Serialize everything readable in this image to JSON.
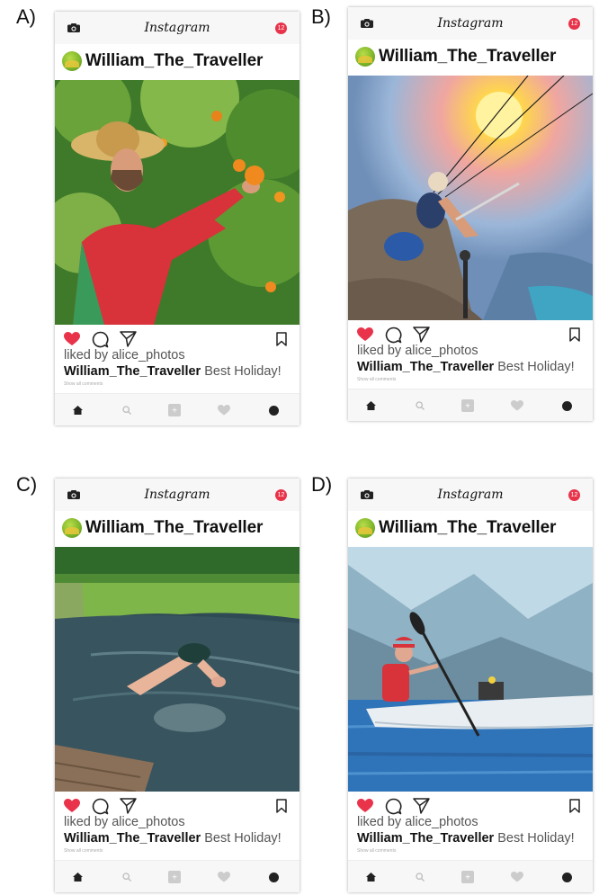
{
  "options": [
    {
      "letter": "A)"
    },
    {
      "letter": "B)"
    },
    {
      "letter": "C)"
    },
    {
      "letter": "D)"
    }
  ],
  "post": {
    "app_name": "Instagram",
    "notification_count": "12",
    "username": "William_The_Traveller",
    "liked_by": "liked by alice_photos",
    "caption_user": "William_The_Traveller",
    "caption_text": "Best Holiday!",
    "show_comments": "Show all comments"
  },
  "nav_add_glyph": "+",
  "icons": {
    "top": [
      "camera-icon",
      "notification-badge"
    ],
    "actions": [
      "heart-icon",
      "comment-icon",
      "share-icon",
      "bookmark-icon"
    ],
    "bottom_nav": [
      "home-icon",
      "search-icon",
      "add-icon",
      "activity-heart-icon",
      "profile-icon"
    ]
  },
  "colors": {
    "like_red": "#e8334a",
    "badge_red": "#e8334a"
  }
}
